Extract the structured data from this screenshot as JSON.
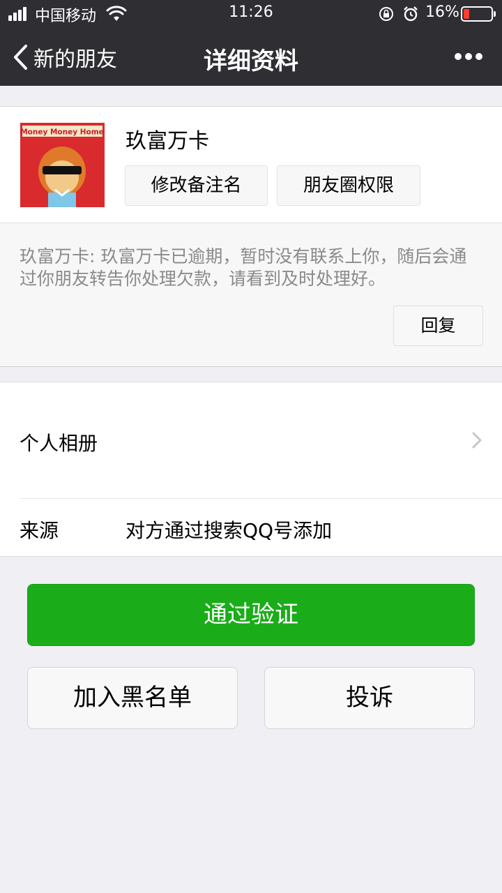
{
  "status_bar": {
    "carrier": "中国移动",
    "time": "11:26",
    "battery_percent": "16%",
    "battery_level": 0.16
  },
  "nav": {
    "back_label": "新的朋友",
    "title": "详细资料",
    "more_icon": "more-dots-icon"
  },
  "profile": {
    "name": "玖富万卡",
    "avatar_text": "Money Money Home",
    "remark_button": "修改备注名",
    "moments_permission_button": "朋友圈权限"
  },
  "message": {
    "text": "玖富万卡: 玖富万卡已逾期，暂时没有联系上你，随后会通过你朋友转告你处理欠款，请看到及时处理好。",
    "reply_button": "回复"
  },
  "info": {
    "album_label": "个人相册",
    "source_label": "来源",
    "source_value": "对方通过搜索QQ号添加"
  },
  "actions": {
    "verify_button": "通过验证",
    "block_button": "加入黑名单",
    "report_button": "投诉"
  },
  "colors": {
    "nav_bg": "#2e2e33",
    "page_bg": "#efeff4",
    "primary_green": "#1aad19",
    "battery_low": "#ff3b30"
  }
}
